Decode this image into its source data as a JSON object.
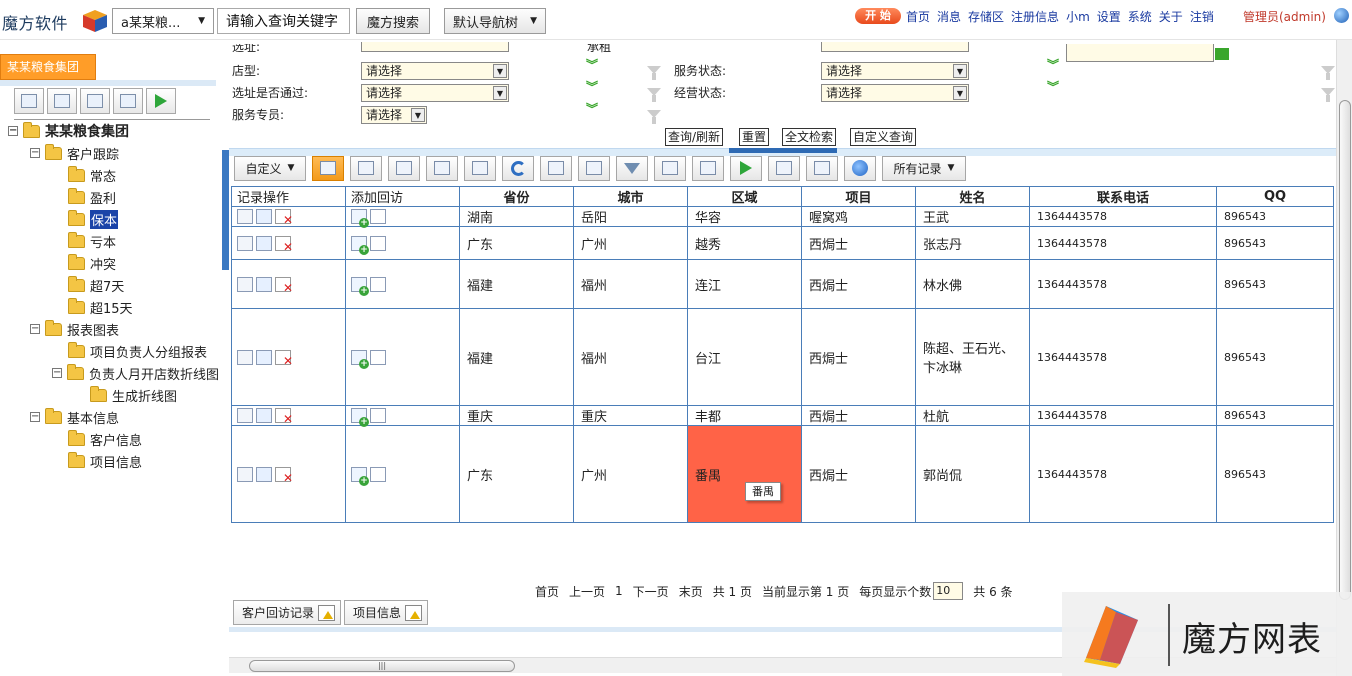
{
  "topbar": {
    "logo_text": "魔方软件",
    "dept_select": "a某某粮...",
    "search_placeholder": "请输入查询关键字",
    "search_button": "魔方搜索",
    "nav_select": "默认导航树",
    "start_badge": "开 始",
    "links": [
      "首页",
      "消息",
      "存储区",
      "注册信息",
      "小m",
      "设置",
      "系统",
      "关于",
      "注销"
    ],
    "admin_label": "管理员(admin)"
  },
  "left": {
    "group_tab": "某某粮食集团",
    "tree": [
      {
        "label": "某某粮食集团",
        "level": 0,
        "toggle": "−",
        "bold": true
      },
      {
        "label": "客户跟踪",
        "level": 1,
        "toggle": "−"
      },
      {
        "label": "常态",
        "level": 2
      },
      {
        "label": "盈利",
        "level": 2
      },
      {
        "label": "保本",
        "level": 2,
        "selected": true
      },
      {
        "label": "亏本",
        "level": 2
      },
      {
        "label": "冲突",
        "level": 2
      },
      {
        "label": "超7天",
        "level": 2
      },
      {
        "label": "超15天",
        "level": 2
      },
      {
        "label": "报表图表",
        "level": 1,
        "toggle": "−"
      },
      {
        "label": "项目负责人分组报表",
        "level": 2
      },
      {
        "label": "负责人月开店数折线图",
        "level": 2,
        "toggle": "−"
      },
      {
        "label": "生成折线图",
        "level": 3
      },
      {
        "label": "基本信息",
        "level": 1,
        "toggle": "−"
      },
      {
        "label": "客户信息",
        "level": 2
      },
      {
        "label": "项目信息",
        "level": 2
      }
    ]
  },
  "filters": {
    "partial_top_left": "选址:",
    "partial_top_mid": "承租",
    "shop_type_label": "店型:",
    "site_pass_label": "选址是否通过:",
    "service_staff_label": "服务专员:",
    "service_state_label": "服务状态:",
    "business_state_label": "经营状态:",
    "select_placeholder": "请选择",
    "buttons": [
      "查询/刷新",
      "重置",
      "全文检索",
      "自定义查询"
    ]
  },
  "toolbar": {
    "custom_label": "自定义",
    "all_records_label": "所有记录"
  },
  "grid": {
    "columns": [
      "记录操作",
      "添加回访",
      "省份",
      "城市",
      "区域",
      "项目",
      "姓名",
      "联系电话",
      "QQ"
    ],
    "rows": [
      {
        "province": "湖南",
        "city": "岳阳",
        "district": "华容",
        "project": "喔窝鸡",
        "name": "王武",
        "phone": "1364443578",
        "qq": "896543"
      },
      {
        "province": "广东",
        "city": "广州",
        "district": "越秀",
        "project": "西焗士",
        "name": "张志丹",
        "phone": "1364443578",
        "qq": "896543"
      },
      {
        "province": "福建",
        "city": "福州",
        "district": "连江",
        "project": "西焗士",
        "name": "林水佛",
        "phone": "1364443578",
        "qq": "896543"
      },
      {
        "province": "福建",
        "city": "福州",
        "district": "台江",
        "project": "西焗士",
        "name": "陈超、王石光、卞冰琳",
        "phone": "1364443578",
        "qq": "896543"
      },
      {
        "province": "重庆",
        "city": "重庆",
        "district": "丰都",
        "project": "西焗士",
        "name": "杜航",
        "phone": "1364443578",
        "qq": "896543"
      },
      {
        "province": "广东",
        "city": "广州",
        "district": "番禺",
        "project": "西焗士",
        "name": "郭尚侃",
        "phone": "1364443578",
        "qq": "896543"
      }
    ],
    "highlight_color": "#ff6347",
    "tooltip": "番禺"
  },
  "pager": {
    "first": "首页",
    "prev": "上一页",
    "current": "1",
    "next": "下一页",
    "last": "末页",
    "total_pages": "共 1 页",
    "current_page_text": "当前显示第 1 页",
    "per_page_label": "每页显示个数",
    "per_page_value": "10",
    "total_records": "共 6 条"
  },
  "bottom_tabs": [
    "客户回访记录",
    "项目信息"
  ],
  "watermark": {
    "text": "魔方网表"
  }
}
